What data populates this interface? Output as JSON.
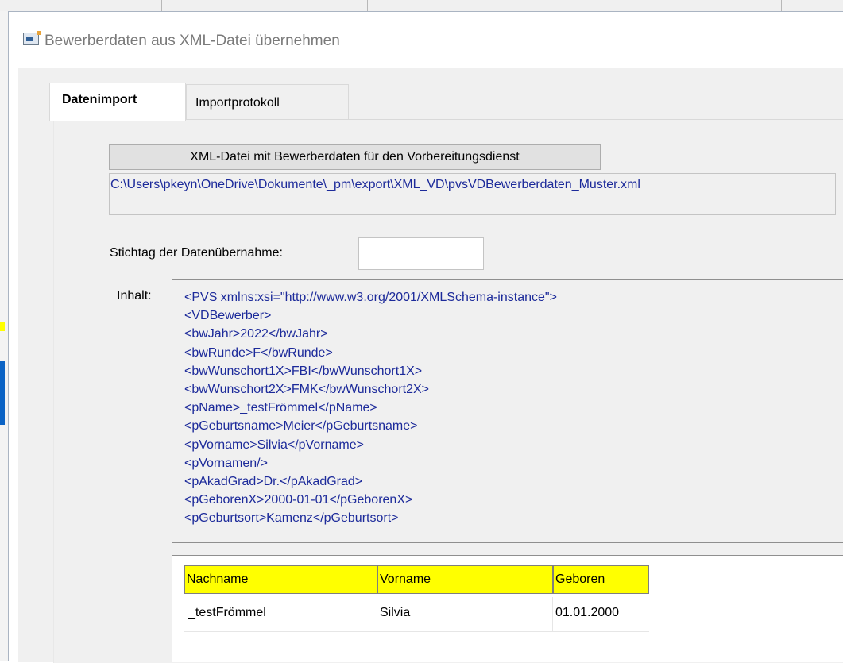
{
  "window": {
    "title": "Bewerberdaten aus XML-Datei übernehmen",
    "icon": "form-window-icon"
  },
  "tabs": [
    {
      "label": "Datenimport",
      "active": true
    },
    {
      "label": "Importprotokoll",
      "active": false
    }
  ],
  "import": {
    "xml_button_label": "XML-Datei mit Bewerberdaten für den Vorbereitungsdienst",
    "file_path": "C:\\Users\\pkeyn\\OneDrive\\Dokumente\\_pm\\export\\XML_VD\\pvsVDBewerberdaten_Muster.xml",
    "stichtag_label": "Stichtag der Datenübernahme:",
    "stichtag_value": "",
    "inhalt_label": "Inhalt:",
    "content_lines": [
      "<PVS xmlns:xsi=\"http://www.w3.org/2001/XMLSchema-instance\">",
      "<VDBewerber>",
      "<bwJahr>2022</bwJahr>",
      "<bwRunde>F</bwRunde>",
      "<bwWunschort1X>FBI</bwWunschort1X>",
      "<bwWunschort2X>FMK</bwWunschort2X>",
      "<pName>_testFrömmel</pName>",
      "<pGeburtsname>Meier</pGeburtsname>",
      "<pVorname>Silvia</pVorname>",
      "<pVornamen/>",
      "<pAkadGrad>Dr.</pAkadGrad>",
      "<pGeborenX>2000-01-01</pGeborenX>",
      "<pGeburtsort>Kamenz</pGeburtsort>"
    ]
  },
  "results": {
    "headers": [
      "Nachname",
      "Vorname",
      "Geboren"
    ],
    "header_color": "#ffff00",
    "rows": [
      [
        "_testFrömmel",
        "Silvia",
        "01.01.2000"
      ]
    ]
  },
  "colors": {
    "content_text": "#1c2a9a",
    "dialog_background": "#f0f0f0"
  }
}
